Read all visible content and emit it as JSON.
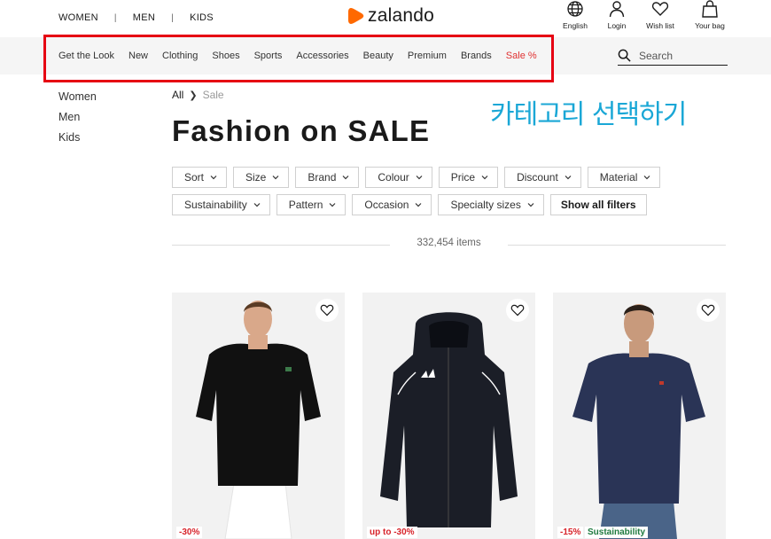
{
  "gender_nav": [
    "WOMEN",
    "MEN",
    "KIDS"
  ],
  "brand": {
    "name": "zalando",
    "color": "#ff6900"
  },
  "utilities": [
    {
      "label": "English",
      "icon": "globe-icon"
    },
    {
      "label": "Login",
      "icon": "user-icon"
    },
    {
      "label": "Wish list",
      "icon": "heart-icon"
    },
    {
      "label": "Your bag",
      "icon": "bag-icon"
    }
  ],
  "categories": [
    "Get the Look",
    "New",
    "Clothing",
    "Shoes",
    "Sports",
    "Accessories",
    "Beauty",
    "Premium",
    "Brands",
    "Sale %"
  ],
  "search": {
    "placeholder": "Search"
  },
  "annotation": "카테고리 선택하기",
  "sidebar": [
    "Women",
    "Men",
    "Kids"
  ],
  "breadcrumb": {
    "root": "All",
    "current": "Sale"
  },
  "page_title": "Fashion on SALE",
  "filters": {
    "row1": [
      "Sort",
      "Size",
      "Brand",
      "Colour",
      "Price",
      "Discount",
      "Material"
    ],
    "row2": [
      "Sustainability",
      "Pattern",
      "Occasion",
      "Specialty sizes"
    ],
    "show_all": "Show all filters"
  },
  "items_count": "332,454 items",
  "products": [
    {
      "badge": "-30%",
      "badge2": "",
      "image": "black-tshirt",
      "shirt_color": "#111111"
    },
    {
      "badge": "up to -30%",
      "badge2": "",
      "image": "black-rain-jacket",
      "shirt_color": "#1b1e27"
    },
    {
      "badge": "-15%",
      "badge2": "Sustainability",
      "image": "navy-tshirt",
      "shirt_color": "#2a3456"
    }
  ],
  "colors": {
    "sale_red": "#e03131",
    "highlight_red": "#e60012",
    "annotation_blue": "#1aa7d6"
  }
}
